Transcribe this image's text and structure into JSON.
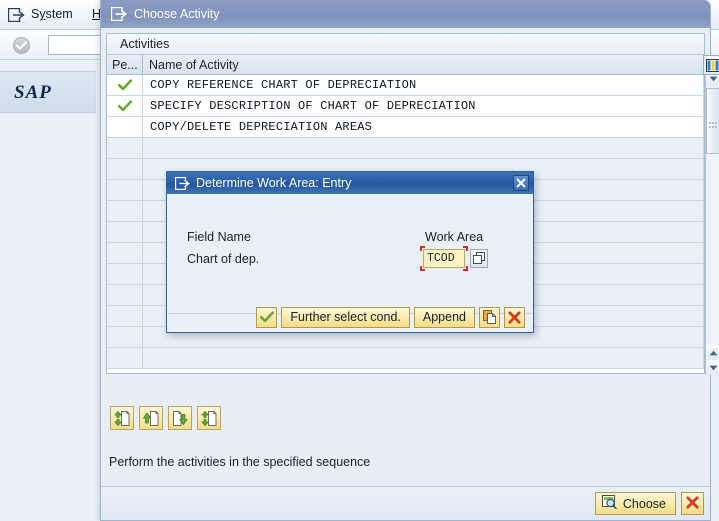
{
  "background": {
    "menu": {
      "icon": "exit-arrow-icon",
      "items": [
        {
          "label": "System",
          "underline_index": 1
        },
        {
          "label": "H",
          "full": "Help"
        }
      ]
    },
    "toolbar": {
      "enter_icon": "enter-checkmark-icon",
      "command_field_value": "",
      "command_field_placeholder": ""
    },
    "logo": "SAP"
  },
  "choose_activity": {
    "title": "Choose Activity",
    "title_icon": "exit-arrow-icon",
    "list_header": "Activities",
    "columns": [
      {
        "key": "pe",
        "label": "Pe..."
      },
      {
        "key": "name",
        "label": "Name of Activity"
      }
    ],
    "rows": [
      {
        "performed": true,
        "status_icon": "green-check-icon",
        "name": "COPY REFERENCE CHART OF DEPRECIATION"
      },
      {
        "performed": true,
        "status_icon": "green-check-icon",
        "name": "SPECIFY DESCRIPTION OF CHART OF DEPRECIATION"
      },
      {
        "performed": false,
        "status_icon": "",
        "name": "COPY/DELETE DEPRECIATION AREAS"
      }
    ],
    "empty_row_count": 11,
    "scrollbar": {
      "up_arrow_icon": "triangle-up-icon",
      "down_arrow_icon": "triangle-down-icon",
      "thumb_grip_icon": "grip-dots-icon",
      "column_config_icon": "column-config-icon"
    },
    "nav_buttons": [
      {
        "name": "first-entry-button",
        "icon": "doc-first-icon"
      },
      {
        "name": "previous-entry-button",
        "icon": "doc-prev-icon"
      },
      {
        "name": "next-entry-button",
        "icon": "doc-next-icon"
      },
      {
        "name": "last-entry-button",
        "icon": "doc-last-icon"
      }
    ],
    "status_text": "Perform the activities in the specified sequence",
    "footer": {
      "choose_label": "Choose",
      "choose_icon": "select-magnifier-icon",
      "cancel_icon": "red-x-icon"
    }
  },
  "work_area_dialog": {
    "title": "Determine Work Area: Entry",
    "title_icon": "exit-arrow-icon",
    "close_icon": "white-x-icon",
    "label_field_name": "Field Name",
    "label_work_area": "Work Area",
    "field_label": "Chart of dep.",
    "field_value": "TCOD",
    "field_placeholder": "",
    "multi_select_icon": "multiple-selection-icon",
    "buttons": [
      {
        "name": "continue-button",
        "icon": "green-check-icon",
        "label": ""
      },
      {
        "name": "further-select-cond-button",
        "icon": "",
        "label": "Further select cond."
      },
      {
        "name": "append-button",
        "icon": "",
        "label": "Append"
      },
      {
        "name": "copy-button",
        "icon": "copy-doc-icon",
        "label": ""
      },
      {
        "name": "cancel-button",
        "icon": "red-x-icon",
        "label": ""
      }
    ]
  },
  "colors": {
    "inactive_title": "#8296bf",
    "active_title": "#2c5da9",
    "field_yellow": "#fdf2c2",
    "focus_red": "#d22a2a",
    "check_green": "#6aa82e",
    "panel_bg": "#eaf0f7",
    "button_yellow": "#fbe9a8"
  }
}
